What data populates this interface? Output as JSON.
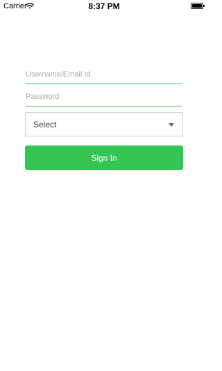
{
  "status_bar": {
    "carrier": "Carrier",
    "time": "8:37 PM"
  },
  "login_form": {
    "username_placeholder": "Username/Email Id",
    "password_placeholder": "Password",
    "select_value": "Select",
    "sign_in_label": "Sign In"
  },
  "colors": {
    "accent": "#34c553",
    "field_underline": "#3cc552",
    "placeholder": "#a9a9a9",
    "select_border": "#cfcfcf"
  }
}
